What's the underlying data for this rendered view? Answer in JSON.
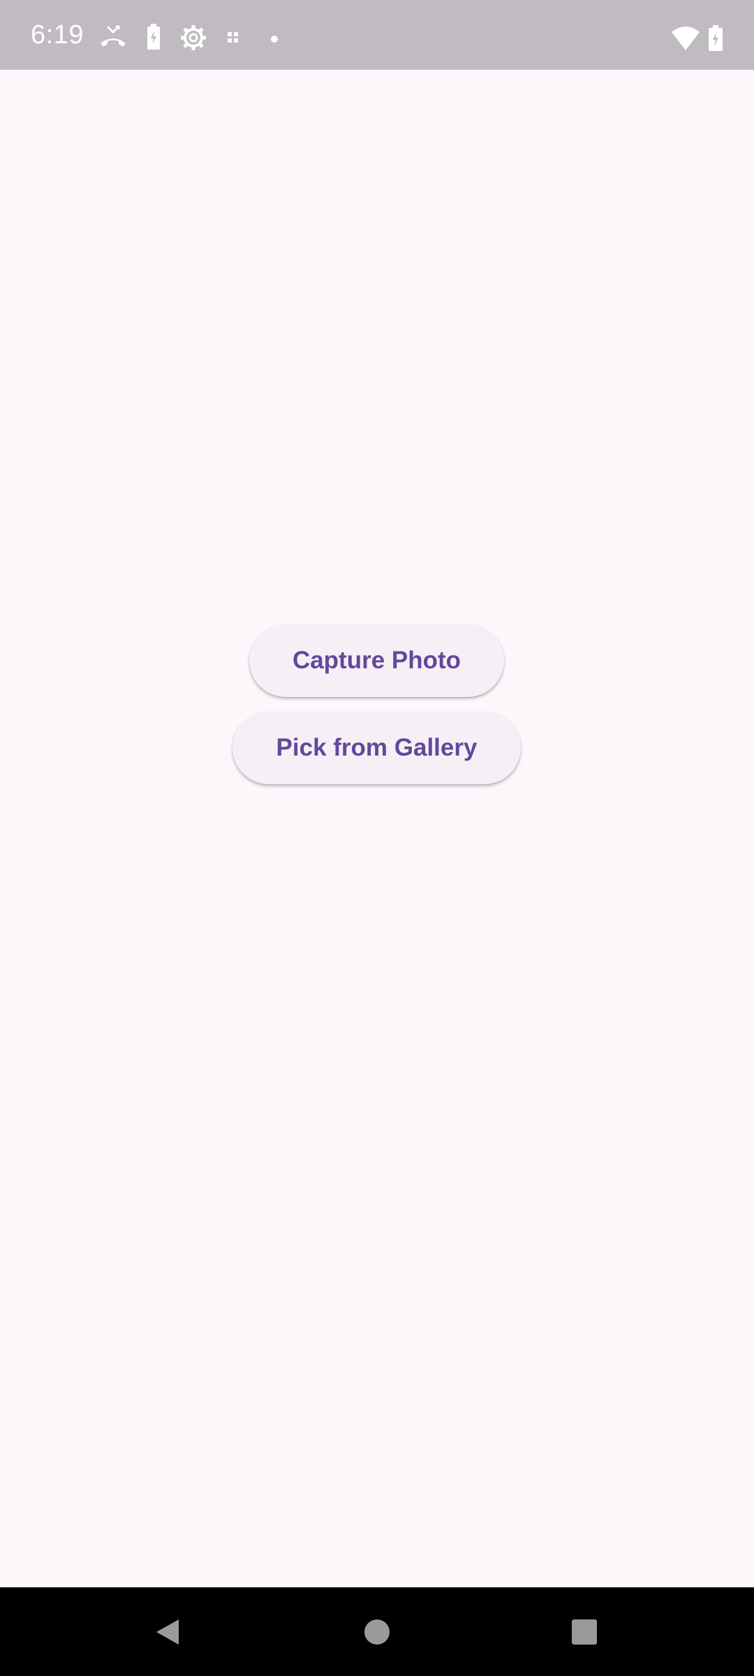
{
  "status_bar": {
    "time": "6:19",
    "left_icons": [
      "missed-call-icon",
      "battery-saver-icon",
      "settings-icon",
      "screenshot-icon",
      "notification-dot-icon"
    ],
    "right_icons": [
      "wifi-icon",
      "battery-icon"
    ]
  },
  "main": {
    "capture_button_label": "Capture Photo",
    "gallery_button_label": "Pick from Gallery"
  },
  "nav_bar": {
    "icons": [
      "back-icon",
      "home-icon",
      "recents-icon"
    ]
  },
  "colors": {
    "background": "#fdf7fc",
    "status_bar": "#bfbbc0",
    "button_background": "#f5f0f6",
    "button_text": "#63489b",
    "nav_bar": "#000000"
  }
}
